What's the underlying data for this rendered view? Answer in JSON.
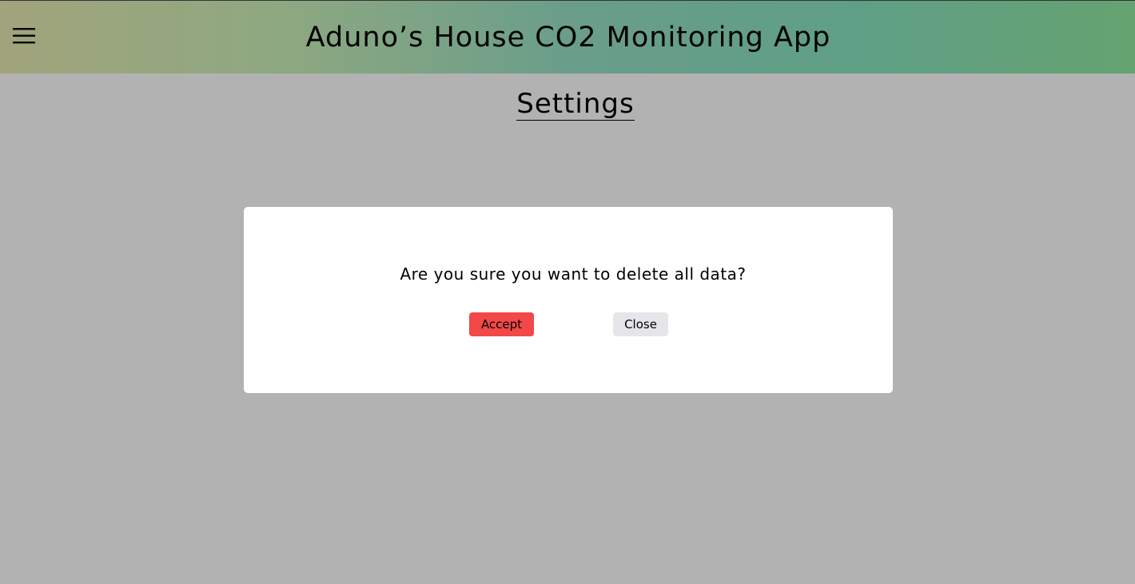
{
  "header": {
    "app_title": "Aduno’s House CO2 Monitoring App",
    "menu_icon": "hamburger-menu-icon"
  },
  "page": {
    "title": "Settings"
  },
  "modal": {
    "message": "Are you sure you want to delete all data?",
    "accept_label": "Accept",
    "close_label": "Close"
  },
  "colors": {
    "overlay_background": "#b2b2b2",
    "header_gradient_start": "#a1a47c",
    "header_gradient_end": "#65a371",
    "accept_button": "#f24848",
    "close_button": "#e6e6ea",
    "modal_background": "#ffffff"
  }
}
